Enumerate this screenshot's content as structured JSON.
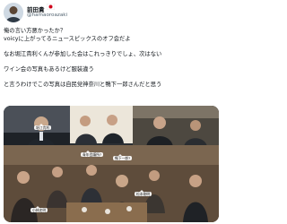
{
  "author": {
    "display_name": "前田貴",
    "handle": "@hamaoroazaki",
    "flag_icon": "japan-flag-icon",
    "avatar_icon": "profile-avatar"
  },
  "tweet": {
    "lines": [
      "俺の言い方悪かったか？",
      "voicyに上がってるニュースピックスのオフ会だよ",
      "なお堀江貴利くんが参加した会はこれっきりでしょ、次はない",
      "ワイン会の写真もあるけど服装違う",
      "と言うわけでこの写真は自民党神奈川と鴨下一郎さんだと思う"
    ]
  },
  "media": {
    "tags": [
      "堀江貴利",
      "青年会議所?",
      "鴨下一郎?",
      "小林史明",
      "松本剛明"
    ]
  }
}
